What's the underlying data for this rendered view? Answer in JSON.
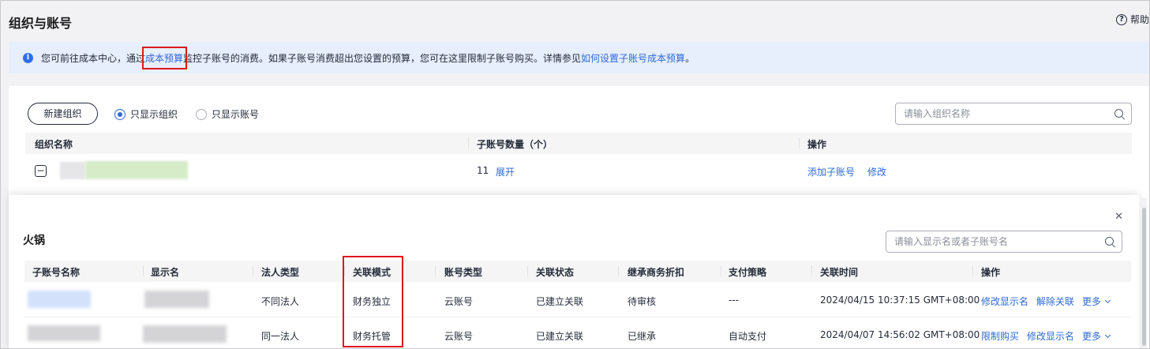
{
  "page": {
    "title": "组织与账号",
    "help": "帮助"
  },
  "notice": {
    "text_1": "您可前往成本中心，通过",
    "link_1": "成本预算",
    "text_2": "监控子账号的消费。如果子账号消费超出您设置的预算，您可在这里限制子账号购买。详情参见",
    "link_2": "如何设置子账号成本预算",
    "text_3": "。"
  },
  "toolbar": {
    "new_org_label": "新建组织",
    "radio_orgs_label": "只显示组织",
    "radio_accounts_label": "只显示账号",
    "selected_radio": "只显示组织",
    "search_placeholder": "请输入组织名称"
  },
  "org_table": {
    "columns": [
      "组织名称",
      "子账号数量（个）",
      "操作"
    ],
    "row": {
      "sub_count": "11",
      "expand_label": "展开",
      "actions": [
        "添加子账号",
        "修改"
      ]
    }
  },
  "panel": {
    "title": "火锅",
    "search_placeholder": "请输入显示名或者子账号名",
    "columns": [
      "子账号名称",
      "显示名",
      "法人类型",
      "关联模式",
      "账号类型",
      "关联状态",
      "继承商务折扣",
      "支付策略",
      "关联时间",
      "操作"
    ],
    "rows": [
      {
        "legal_type": "不同法人",
        "link_mode": "财务独立",
        "account_type": "云账号",
        "link_status": "已建立关联",
        "discount": "待审核",
        "payment": "---",
        "time": "2024/04/15 10:37:15 GMT+08:00",
        "actions": [
          "修改显示名",
          "解除关联",
          "更多"
        ]
      },
      {
        "legal_type": "同一法人",
        "link_mode": "财务托管",
        "account_type": "云账号",
        "link_status": "已建立关联",
        "discount": "已继承",
        "payment": "自动支付",
        "time": "2024/04/07 14:56:02 GMT+08:00",
        "actions": [
          "限制购买",
          "修改显示名",
          "更多"
        ]
      }
    ]
  },
  "colors": {
    "link": "#2e6ad8",
    "notice_bg": "#e7eefc",
    "highlight": "#e0161d"
  }
}
